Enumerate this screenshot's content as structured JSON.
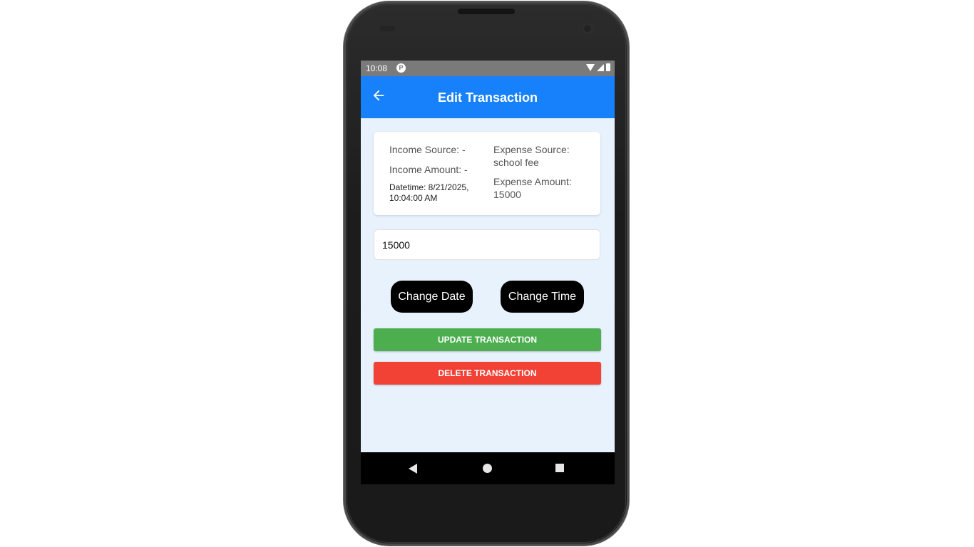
{
  "statusbar": {
    "time": "10:08",
    "app_icon_letter": "P",
    "icons": [
      "wifi-icon",
      "signal-icon",
      "battery-icon"
    ]
  },
  "appbar": {
    "title": "Edit Transaction",
    "back_icon": "arrow-left-icon",
    "color": "#1781fb"
  },
  "details": {
    "income_source": "Income Source: -",
    "income_amount": "Income Amount: -",
    "datetime": "Datetime: 8/21/2025, 10:04:00 AM",
    "expense_source": "Expense Source: school fee",
    "expense_amount": "Expense Amount: 15000"
  },
  "amount_input": {
    "value": "15000"
  },
  "buttons": {
    "change_date": "Change Date",
    "change_time": "Change Time",
    "update": "UPDATE TRANSACTION",
    "delete": "DELETE TRANSACTION"
  },
  "colors": {
    "update": "#4cae4f",
    "delete": "#f24236",
    "screen_bg": "#e8f2fd"
  },
  "navbar": {
    "icons": [
      "back-triangle-icon",
      "home-circle-icon",
      "recents-square-icon"
    ]
  }
}
